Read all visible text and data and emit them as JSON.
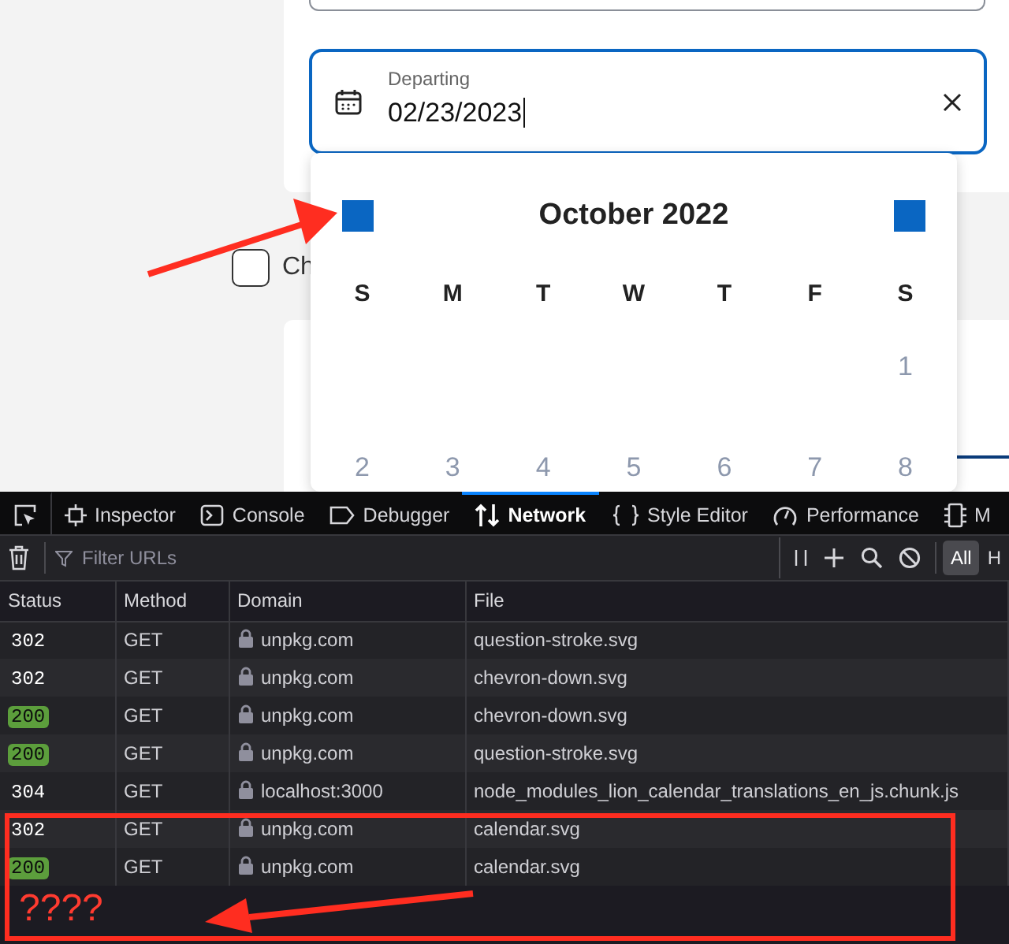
{
  "form": {
    "date_field": {
      "label": "Departing",
      "value": "02/23/2023"
    },
    "calendar": {
      "month": "October 2022",
      "weekdays": [
        "S",
        "M",
        "T",
        "W",
        "T",
        "F",
        "S"
      ],
      "weeks": [
        [
          "1"
        ],
        [
          "2",
          "3",
          "4",
          "5",
          "6",
          "7",
          "8"
        ]
      ]
    },
    "checkbox": {
      "label": "Ch",
      "checked": false
    }
  },
  "devtools": {
    "tabs": [
      {
        "kind": "picker",
        "selected": false
      },
      {
        "kind": "inspector",
        "label": "Inspector",
        "selected": false
      },
      {
        "kind": "console",
        "label": "Console",
        "selected": false
      },
      {
        "kind": "debugger",
        "label": "Debugger",
        "selected": false
      },
      {
        "kind": "network",
        "label": "Network",
        "selected": true
      },
      {
        "kind": "style",
        "label": "Style Editor",
        "selected": false
      },
      {
        "kind": "performance",
        "label": "Performance",
        "selected": false
      },
      {
        "kind": "memory",
        "label": "M",
        "selected": false
      }
    ],
    "filter": {
      "placeholder": "Filter URLs"
    },
    "type_filters": [
      {
        "label": "All",
        "selected": true
      },
      {
        "label": "H",
        "selected": false
      }
    ],
    "columns": [
      "Status",
      "Method",
      "Domain",
      "File"
    ],
    "requests": [
      {
        "status": "302",
        "ok": false,
        "method": "GET",
        "domain": "unpkg.com",
        "file": "question-stroke.svg"
      },
      {
        "status": "302",
        "ok": false,
        "method": "GET",
        "domain": "unpkg.com",
        "file": "chevron-down.svg"
      },
      {
        "status": "200",
        "ok": true,
        "method": "GET",
        "domain": "unpkg.com",
        "file": "chevron-down.svg"
      },
      {
        "status": "200",
        "ok": true,
        "method": "GET",
        "domain": "unpkg.com",
        "file": "question-stroke.svg"
      },
      {
        "status": "304",
        "ok": false,
        "method": "GET",
        "domain": "localhost:3000",
        "file": "node_modules_lion_calendar_translations_en_js.chunk.js"
      },
      {
        "status": "302",
        "ok": false,
        "method": "GET",
        "domain": "unpkg.com",
        "file": "calendar.svg"
      },
      {
        "status": "200",
        "ok": true,
        "method": "GET",
        "domain": "unpkg.com",
        "file": "calendar.svg"
      }
    ]
  },
  "annotation": {
    "note": "????"
  }
}
